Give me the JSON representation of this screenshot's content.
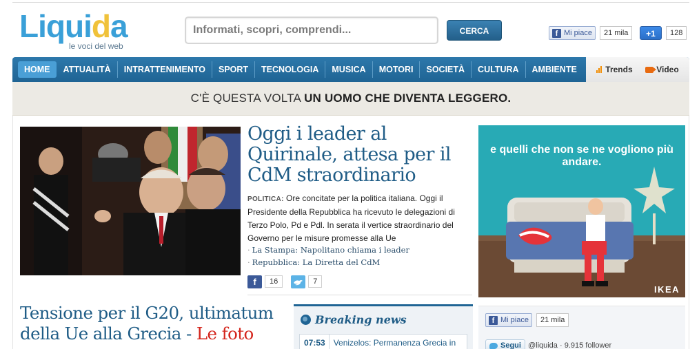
{
  "header": {
    "logo_letters": [
      "L",
      "i",
      "q",
      "u",
      "i",
      "d",
      "a"
    ],
    "logo_colors": [
      "#3aa0d8",
      "#3aa0d8",
      "#3aa0d8",
      "#3aa0d8",
      "#3aa0d8",
      "#f0c23a",
      "#3aa0d8"
    ],
    "tagline": "le voci del web",
    "search_placeholder": "Informati, scopri, comprendi...",
    "search_button": "CERCA",
    "fb_like_label": "Mi piace",
    "fb_like_count": "21 mila",
    "gplus_label": "+1",
    "gplus_count": "128"
  },
  "nav": {
    "items": [
      "HOME",
      "ATTUALITÀ",
      "INTRATTENIMENTO",
      "SPORT",
      "TECNOLOGIA",
      "MUSICA",
      "MOTORI",
      "SOCIETÀ",
      "CULTURA",
      "AMBIENTE"
    ],
    "active_index": 0,
    "trends_label": "Trends",
    "video_label": "Video"
  },
  "banner": {
    "prefix": "C'È QUESTA VOLTA ",
    "bold": "UN UOMO CHE DIVENTA LEGGERO."
  },
  "main_story": {
    "headline": "Oggi i leader al Quirinale, attesa per il CdM straordinario",
    "category": "POLITICA:",
    "body": " Ore concitate per la politica italiana. Oggi il Presidente della Repubblica ha ricevuto le delegazioni di Terzo Polo, Pd e Pdl. In serata il vertice straordinario del Governo per le misure promesse alla Ue",
    "related": [
      "La Stampa: Napolitano chiama i leader",
      "Repubblica: La Diretta del CdM"
    ],
    "fb_icon": "f",
    "fb_count": "16",
    "tw_count": "7"
  },
  "second_story": {
    "headline": "Tensione per il G20, ultimatum della Ue alla Grecia - ",
    "highlight": "Le foto"
  },
  "breaking": {
    "title": "Breaking news",
    "time": "07:53",
    "text": "Venizelos: Permanenza Grecia in"
  },
  "ad": {
    "text": "e quelli che non se ne vogliono più andare.",
    "brand": "IKEA"
  },
  "right_social": {
    "like_label": "Mi piace",
    "like_count": "21 mila",
    "follow_label": "Segui",
    "handle": "@liquida",
    "followers": "· 9.915 follower"
  }
}
